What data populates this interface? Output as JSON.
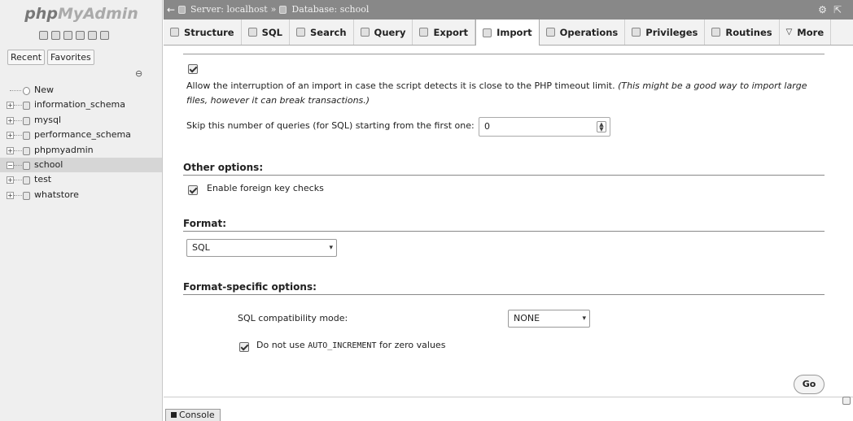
{
  "sidebar": {
    "logo_php": "php",
    "logo_ma": "MyAdmin",
    "tabs": [
      "Recent",
      "Favorites"
    ],
    "tree": [
      {
        "label": "New",
        "exp": ""
      },
      {
        "label": "information_schema",
        "exp": "+"
      },
      {
        "label": "mysql",
        "exp": "+"
      },
      {
        "label": "performance_schema",
        "exp": "+"
      },
      {
        "label": "phpmyadmin",
        "exp": "+"
      },
      {
        "label": "school",
        "exp": "−"
      },
      {
        "label": "test",
        "exp": "+"
      },
      {
        "label": "whatstore",
        "exp": "+"
      }
    ]
  },
  "breadcrumb": {
    "server": "Server: localhost",
    "sep": "»",
    "database": "Database: school"
  },
  "tabs": [
    "Structure",
    "SQL",
    "Search",
    "Query",
    "Export",
    "Import",
    "Operations",
    "Privileges",
    "Routines",
    "More"
  ],
  "active_tab": "Import",
  "main": {
    "interrupt_text": "Allow the interruption of an import in case the script detects it is close to the PHP timeout limit.",
    "interrupt_note": "(This might be a good way to import large files, however it can break transactions.)",
    "skip_label": "Skip this number of queries (for SQL) starting from the first one:",
    "skip_value": "0",
    "other_options_heading": "Other options:",
    "foreign_key_label": "Enable foreign key checks",
    "format_heading": "Format:",
    "format_value": "SQL",
    "format_specific_heading": "Format-specific options:",
    "compat_label": "SQL compatibility mode:",
    "compat_value": "NONE",
    "ai_label_pre": "Do not use",
    "ai_code": "AUTO_INCREMENT",
    "ai_label_post": "for zero values",
    "go_label": "Go"
  },
  "console_label": "Console"
}
